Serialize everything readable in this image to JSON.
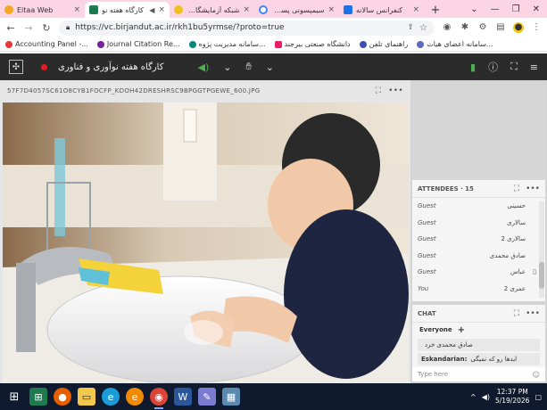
{
  "browser": {
    "tabs": [
      {
        "title": "Eitaa Web",
        "color": "#f5a623",
        "active": false
      },
      {
        "title": "کارگاه هفته نو",
        "color": "#1e7b4f",
        "active": true
      },
      {
        "title": "شبکه آزمایشگاه ها",
        "color": "#f0c020",
        "active": false
      },
      {
        "title": "سیمپسونی پسرانه",
        "color": "#4285f4",
        "active": false
      },
      {
        "title": "کنفرانس سالانه",
        "color": "#1a73e8",
        "active": false
      }
    ],
    "new_tab": "+",
    "url": "https://vc.birjandut.ac.ir/rkh1bu5yrmse/?proto=true",
    "bookmarks": [
      {
        "label": "Accounting Panel -...",
        "color": "#e53935"
      },
      {
        "label": "Journal Citation Re...",
        "color": "#7b1fa2"
      },
      {
        "label": "سامانه مدیریت پژوه...",
        "color": "#00897b"
      },
      {
        "label": "دانشگاه صنعتی بیرجند",
        "color": "#e91e63"
      },
      {
        "label": "راهنمای تلفن",
        "color": "#3f51b5"
      },
      {
        "label": "سامانه اعضای هیات...",
        "color": "#5c6bc0"
      }
    ]
  },
  "meeting": {
    "title": "کارگاه هفته نوآوری و فناوری"
  },
  "share": {
    "filename": "57F7D4057SC61O8CYB1FOCFP_KDOH42DRESHRSC9BPGGTPGEWE_600.JPG"
  },
  "attendees": {
    "header": "ATTENDEES · 15",
    "rows": [
      {
        "name": "حسینی",
        "role": "Guest",
        "device": ""
      },
      {
        "name": "سالاری",
        "role": "Guest",
        "device": ""
      },
      {
        "name": "سالاری 2",
        "role": "Guest",
        "device": ""
      },
      {
        "name": "صادق محمدی",
        "role": "Guest",
        "device": ""
      },
      {
        "name": "عباس",
        "role": "Guest",
        "device": "▯"
      },
      {
        "name": "عمری 2",
        "role": "You",
        "device": ""
      }
    ]
  },
  "chat": {
    "header": "CHAT",
    "everyone": "Everyone",
    "messages": [
      {
        "from": "",
        "text": "صادق محمدی خرد"
      },
      {
        "from": "Eskandarian:",
        "text": "ایدها رو که نمیگی"
      }
    ],
    "input_placeholder": "Type here"
  },
  "taskbar": {
    "time": "12:37 PM",
    "date": "5/19/2026"
  }
}
